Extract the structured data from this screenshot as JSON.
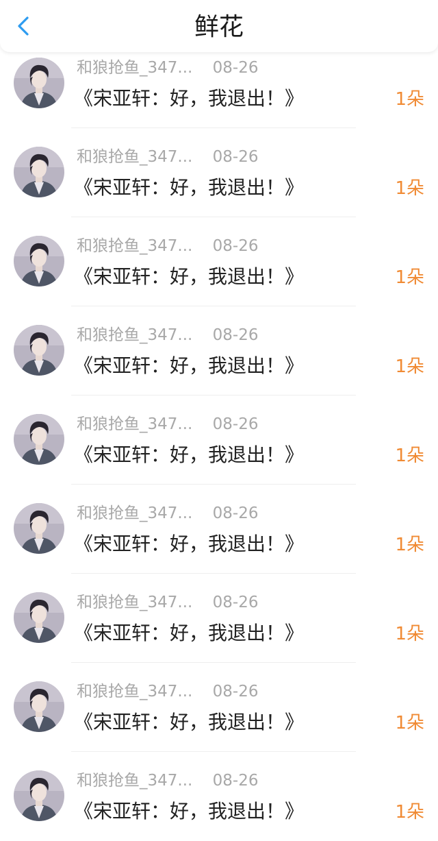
{
  "header": {
    "title": "鲜花",
    "back_icon": "chevron-left-icon",
    "accent_color": "#2d9cf0"
  },
  "colors": {
    "count": "#f08a33",
    "meta": "#a8a8a8",
    "title": "#222222"
  },
  "items": [
    {
      "user": "和狼抢鱼_347...",
      "date": "08-26",
      "book": "《宋亚轩：好，我退出！》",
      "count": "1朵"
    },
    {
      "user": "和狼抢鱼_347...",
      "date": "08-26",
      "book": "《宋亚轩：好，我退出！》",
      "count": "1朵"
    },
    {
      "user": "和狼抢鱼_347...",
      "date": "08-26",
      "book": "《宋亚轩：好，我退出！》",
      "count": "1朵"
    },
    {
      "user": "和狼抢鱼_347...",
      "date": "08-26",
      "book": "《宋亚轩：好，我退出！》",
      "count": "1朵"
    },
    {
      "user": "和狼抢鱼_347...",
      "date": "08-26",
      "book": "《宋亚轩：好，我退出！》",
      "count": "1朵"
    },
    {
      "user": "和狼抢鱼_347...",
      "date": "08-26",
      "book": "《宋亚轩：好，我退出！》",
      "count": "1朵"
    },
    {
      "user": "和狼抢鱼_347...",
      "date": "08-26",
      "book": "《宋亚轩：好，我退出！》",
      "count": "1朵"
    },
    {
      "user": "和狼抢鱼_347...",
      "date": "08-26",
      "book": "《宋亚轩：好，我退出！》",
      "count": "1朵"
    },
    {
      "user": "和狼抢鱼_347...",
      "date": "08-26",
      "book": "《宋亚轩：好，我退出！》",
      "count": "1朵"
    }
  ]
}
